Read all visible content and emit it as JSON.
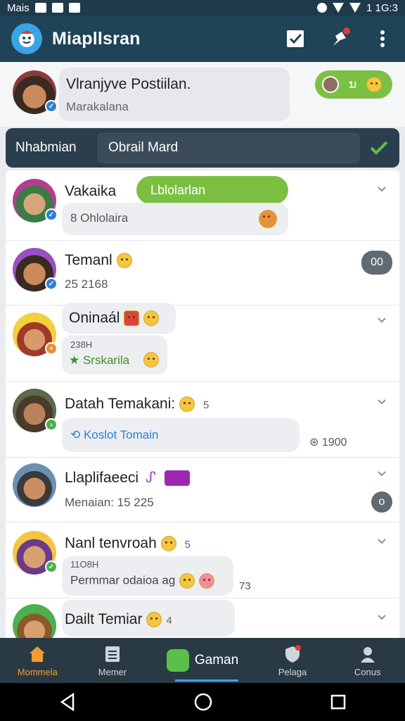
{
  "status_bar": {
    "left_text": "Mais",
    "time": "1 1G:3"
  },
  "app_bar": {
    "title": "Miapllsran"
  },
  "profile": {
    "name": "Vlranjyve Postiilan.",
    "subtitle": "Marakalana",
    "pill_text": "ນ"
  },
  "search": {
    "label": "Nhabmian",
    "value": "Obrail Mard"
  },
  "chats": [
    {
      "name": "Vakaika",
      "tag": "Lblolarlan",
      "sub": "8 Ohlolaira",
      "accent": "#7bc043"
    },
    {
      "name": "Temanl",
      "sub": "25 2168",
      "count": "00"
    },
    {
      "name": "Oninaál",
      "small": "238H",
      "sub": "Srskarila"
    },
    {
      "name": "Datah Temakani:",
      "meta": "5",
      "link": "Koslot Tomain",
      "side": "1900"
    },
    {
      "name": "Llaplifaeeci",
      "sub": "Menaian: 15 225",
      "count": "o"
    },
    {
      "name": "Nanl tenvroah",
      "meta": "5",
      "small": "11O8H",
      "sub": "Permmar odaioa ag",
      "side": "73"
    },
    {
      "name": "Dailt Temiar",
      "meta": "4"
    }
  ],
  "bottom_nav": {
    "home": "Mommela",
    "menu": "Memer",
    "center": "Gaman",
    "pelage": "Pelaga",
    "contacts": "Conus"
  },
  "colors": {
    "app_bar": "#1f4357",
    "accent_green": "#7bc043",
    "active_orange": "#f39c35"
  }
}
